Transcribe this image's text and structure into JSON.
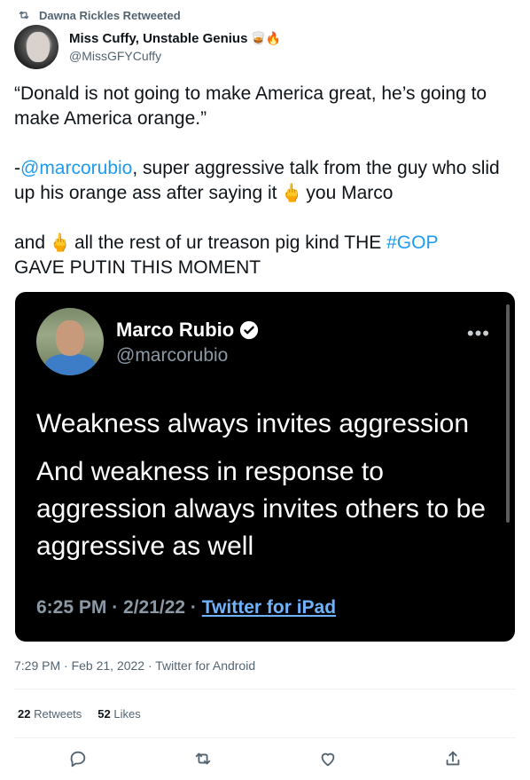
{
  "retweet": {
    "text": "Dawna Rickles Retweeted",
    "icon": "retweet-icon"
  },
  "author": {
    "name": "Miss Cuffy, Unstable Genius",
    "name_emoji": "🥃🔥",
    "handle": "@MissGFYCuffy"
  },
  "tweet": {
    "line1": "“Donald is not going to make America great, he’s going to make America orange.”",
    "p2_prefix": "-",
    "p2_mention": "@marcorubio",
    "p2_text_a": ", super aggressive talk from the guy who slid up his orange ass after saying it",
    "p2_text_b": "you Marco",
    "p3_a": "and",
    "p3_b": "all the rest of ur treason pig kind THE",
    "p3_hashtag": "#GOP",
    "p3_c": "GAVE PUTIN THIS MOMENT",
    "finger_emoji": "🖕"
  },
  "embed": {
    "name": "Marco Rubio",
    "handle": "@marcorubio",
    "more": "•••",
    "text1": "Weakness always invites aggression",
    "text2": "And weakness in response to aggression always invites others to be aggressive as well",
    "time": "6:25 PM · 2/21/22 ·",
    "source": "Twitter for iPad"
  },
  "meta": {
    "timestamp": "7:29 PM · Feb 21, 2022 · Twitter for Android"
  },
  "stats": {
    "retweets_count": "22",
    "retweets_label": "Retweets",
    "likes_count": "52",
    "likes_label": "Likes"
  },
  "colors": {
    "link": "#1d9bf0",
    "muted": "#536471",
    "embed_bg": "#000000"
  }
}
